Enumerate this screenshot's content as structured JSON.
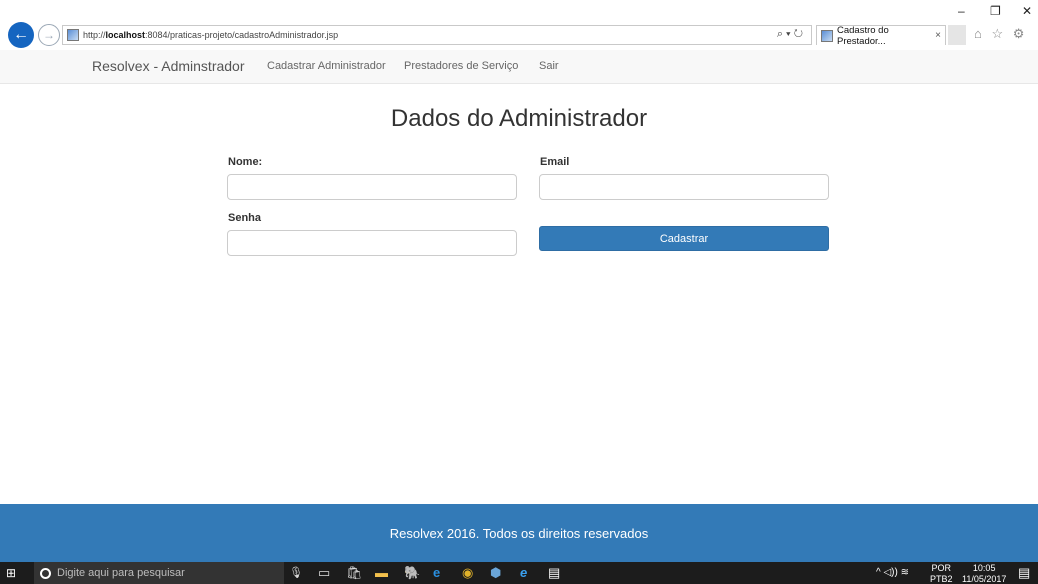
{
  "browser": {
    "url_prefix": "http://",
    "url_host": "localhost",
    "url_rest": ":8084/praticas-projeto/cadastroAdministrador.jsp",
    "search_glyph": "⌕ ▾ ↻",
    "tab_title": "Cadastro do Prestador...",
    "tab_close": "×",
    "window_controls": {
      "minimize": "–",
      "restore": "❐",
      "close": "✕"
    },
    "toolbar_icons": "⌂ ☆ ⚙"
  },
  "navbar": {
    "brand": "Resolvex - Adminstrador",
    "links": [
      "Cadastrar Administrador",
      "Prestadores de Serviço",
      "Sair"
    ]
  },
  "form": {
    "title": "Dados do Administrador",
    "nome_label": "Nome:",
    "nome_value": "",
    "email_label": "Email",
    "email_value": "",
    "senha_label": "Senha",
    "senha_value": "",
    "submit_label": "Cadastrar"
  },
  "footer": {
    "text": "Resolvex 2016. Todos os direitos reservados"
  },
  "taskbar": {
    "search_placeholder": "Digite aqui para pesquisar",
    "lang_top": "POR",
    "lang_bottom": "PTB2",
    "time": "10:05",
    "date": "11/05/2017"
  },
  "colors": {
    "primary": "#337ab7",
    "navbar_bg": "#f8f8f8",
    "taskbar_bg": "#1c1c1c"
  }
}
